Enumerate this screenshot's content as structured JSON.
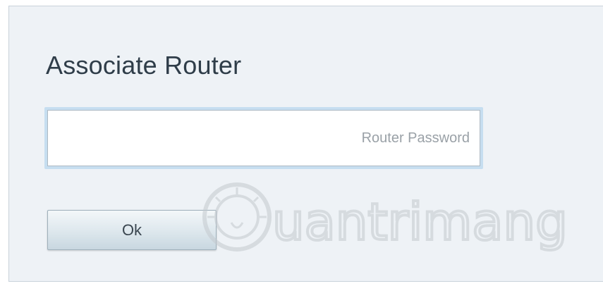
{
  "dialog": {
    "title": "Associate Router",
    "password_placeholder": "Router Password",
    "password_value": "",
    "ok_label": "Ok"
  },
  "watermark": {
    "brand": "Quantrimang",
    "icon": "lightbulb-icon"
  }
}
